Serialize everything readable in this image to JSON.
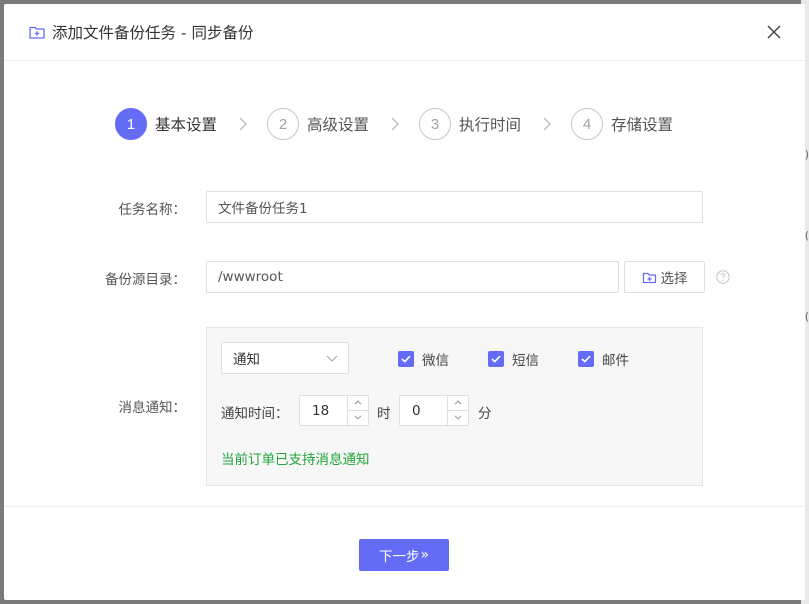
{
  "dialog": {
    "title": "添加文件备份任务 - 同步备份",
    "folder_icon": "folder-plus-icon",
    "close_icon": "close-icon"
  },
  "steps": [
    {
      "num": "1",
      "label": "基本设置",
      "active": true
    },
    {
      "num": "2",
      "label": "高级设置",
      "active": false
    },
    {
      "num": "3",
      "label": "执行时间",
      "active": false
    },
    {
      "num": "4",
      "label": "存储设置",
      "active": false
    }
  ],
  "form": {
    "task_name_label": "任务名称：",
    "task_name_value": "文件备份任务1",
    "source_dir_label": "备份源目录：",
    "source_dir_value": "/wwwroot",
    "choose_label": "选择",
    "notify_label": "消息通知："
  },
  "notify": {
    "select_value": "通知",
    "wechat_label": "微信",
    "sms_label": "短信",
    "email_label": "邮件",
    "time_label": "通知时间：",
    "hour_value": "18",
    "hour_unit": "时",
    "minute_value": "0",
    "minute_unit": "分",
    "support_text": "当前订单已支持消息通知"
  },
  "footer": {
    "next_label": "下一步",
    "next_arrows": "»"
  },
  "colors": {
    "accent": "#646cf6",
    "success": "#20a53a"
  }
}
